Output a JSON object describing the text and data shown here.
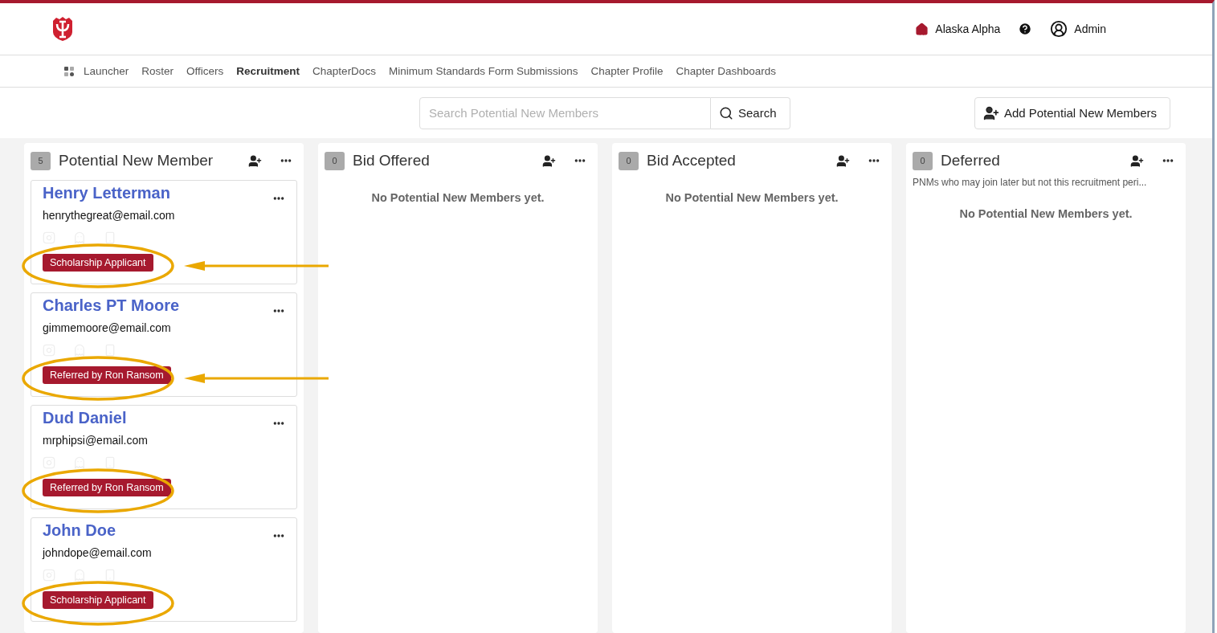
{
  "header": {
    "chapter": "Alaska Alpha",
    "user": "Admin"
  },
  "nav": [
    {
      "label": "Launcher",
      "selected": false
    },
    {
      "label": "Roster",
      "selected": false
    },
    {
      "label": "Officers",
      "selected": false
    },
    {
      "label": "Recruitment",
      "selected": true
    },
    {
      "label": "ChapterDocs",
      "selected": false
    },
    {
      "label": "Minimum Standards Form Submissions",
      "selected": false
    },
    {
      "label": "Chapter Profile",
      "selected": false
    },
    {
      "label": "Chapter Dashboards",
      "selected": false
    }
  ],
  "search": {
    "placeholder": "Search Potential New Members",
    "button": "Search"
  },
  "add_button": "Add Potential New Members",
  "columns": [
    {
      "count": "5",
      "title": "Potential New Member",
      "cards": [
        {
          "name": "Henry Letterman",
          "email": "henrythegreat@email.com",
          "tag": "Scholarship Applicant",
          "circled": true,
          "arrow": true
        },
        {
          "name": "Charles PT Moore",
          "email": "gimmemoore@email.com",
          "tag": "Referred by Ron Ransom",
          "circled": true,
          "arrow": true
        },
        {
          "name": "Dud Daniel",
          "email": "mrphipsi@email.com",
          "tag": "Referred by Ron Ransom",
          "circled": true,
          "arrow": false
        },
        {
          "name": "John Doe",
          "email": "johndope@email.com",
          "tag": "Scholarship Applicant",
          "circled": true,
          "arrow": false
        }
      ]
    },
    {
      "count": "0",
      "title": "Bid Offered",
      "empty": "No Potential New Members yet."
    },
    {
      "count": "0",
      "title": "Bid Accepted",
      "empty": "No Potential New Members yet."
    },
    {
      "count": "0",
      "title": "Deferred",
      "description": "PNMs who may join later but not this recruitment peri...",
      "empty": "No Potential New Members yet."
    }
  ]
}
